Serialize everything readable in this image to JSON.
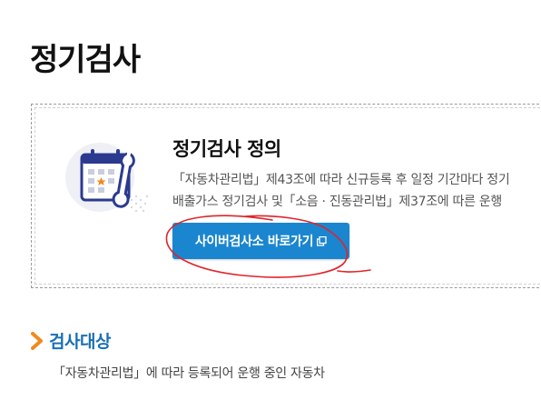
{
  "page": {
    "title": "정기검사"
  },
  "definition": {
    "title": "정기검사 정의",
    "lines": [
      "「자동차관리법」제43조에 따라 신규등록 후 일정 기간마다 정기",
      "배출가스 정기검사 및「소음 · 진동관리법」제37조에 따른 운행"
    ],
    "button_label": "사이버검사소 바로가기",
    "button_icon": "external-link-icon"
  },
  "section": {
    "title": "검사대상",
    "description": "「자동차관리법」에 따라 등록되어 운행 중인 자동차"
  },
  "colors": {
    "accent_blue": "#1a86d0",
    "section_blue": "#1a6fb5",
    "chevron_orange": "#f08a1c",
    "annotation_red": "#e0242a"
  }
}
